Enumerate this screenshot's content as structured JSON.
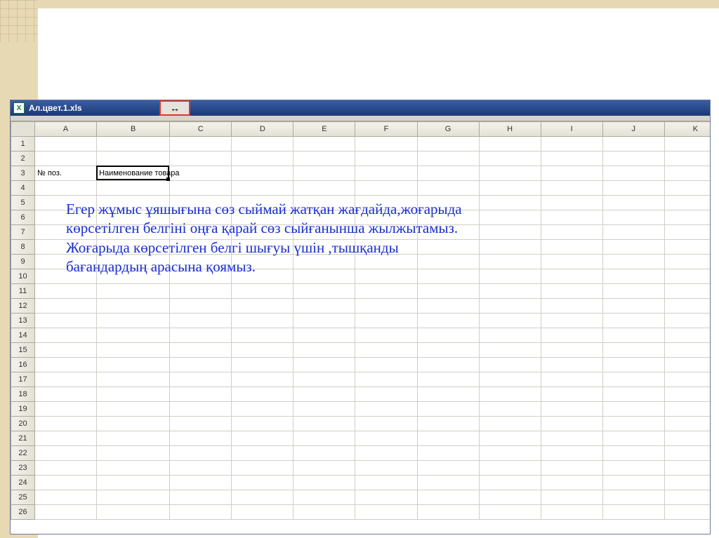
{
  "window": {
    "title": "Ал.цвет.1.xls",
    "excel_glyph": "X"
  },
  "resize_cursor_glyph": "↔",
  "columns": [
    "A",
    "B",
    "C",
    "D",
    "E",
    "F",
    "G",
    "H",
    "I",
    "J",
    "K"
  ],
  "rows": [
    "1",
    "2",
    "3",
    "4",
    "5",
    "6",
    "7",
    "8",
    "9",
    "10",
    "11",
    "12",
    "13",
    "14",
    "15",
    "16",
    "17",
    "18",
    "19",
    "20",
    "21",
    "22",
    "23",
    "24",
    "25",
    "26"
  ],
  "cells": {
    "A3": "№ поз.",
    "B3": "Наименование товара"
  },
  "active_cell": "B3",
  "annotation": {
    "line1": "Егер  жұмыс ұяшығына сөз сыймай жатқан жағдайда,жоғарыда көрсетілген белгіні оңға қарай сөз сыйғанынша жылжытамыз.",
    "line2": "Жоғарыда көрсетілген белгі шығуы үшін ,тышқанды бағандардың арасына  қоямыз."
  }
}
